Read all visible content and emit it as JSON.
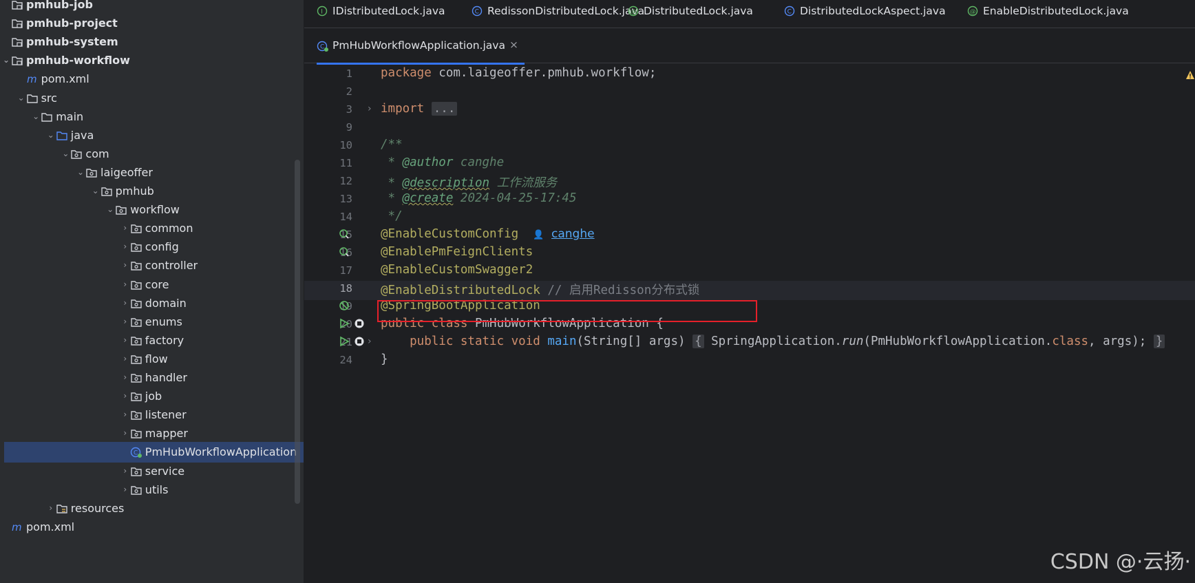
{
  "project_tree": {
    "items": [
      {
        "label": "pmhub-job",
        "bold": true,
        "icon": "module-folder-icon",
        "depth": 0,
        "chevron": "none"
      },
      {
        "label": "pmhub-project",
        "bold": true,
        "icon": "module-folder-icon",
        "depth": 0,
        "chevron": "none"
      },
      {
        "label": "pmhub-system",
        "bold": true,
        "icon": "module-folder-icon",
        "depth": 0,
        "chevron": "none"
      },
      {
        "label": "pmhub-workflow",
        "bold": true,
        "icon": "module-folder-icon",
        "depth": 0,
        "chevron": "down"
      },
      {
        "label": "pom.xml",
        "icon": "maven-icon",
        "depth": 1,
        "chevron": "none"
      },
      {
        "label": "src",
        "icon": "folder-icon",
        "depth": 1,
        "chevron": "down"
      },
      {
        "label": "main",
        "icon": "folder-icon",
        "depth": 2,
        "chevron": "down"
      },
      {
        "label": "java",
        "icon": "source-folder-icon",
        "depth": 3,
        "chevron": "down"
      },
      {
        "label": "com",
        "icon": "package-icon",
        "depth": 4,
        "chevron": "down"
      },
      {
        "label": "laigeoffer",
        "icon": "package-icon",
        "depth": 5,
        "chevron": "down"
      },
      {
        "label": "pmhub",
        "icon": "package-icon",
        "depth": 6,
        "chevron": "down"
      },
      {
        "label": "workflow",
        "icon": "package-icon",
        "depth": 7,
        "chevron": "down"
      },
      {
        "label": "common",
        "icon": "package-icon",
        "depth": 8,
        "chevron": "right"
      },
      {
        "label": "config",
        "icon": "package-icon",
        "depth": 8,
        "chevron": "right"
      },
      {
        "label": "controller",
        "icon": "package-icon",
        "depth": 8,
        "chevron": "right"
      },
      {
        "label": "core",
        "icon": "package-icon",
        "depth": 8,
        "chevron": "right"
      },
      {
        "label": "domain",
        "icon": "package-icon",
        "depth": 8,
        "chevron": "right"
      },
      {
        "label": "enums",
        "icon": "package-icon",
        "depth": 8,
        "chevron": "right"
      },
      {
        "label": "factory",
        "icon": "package-icon",
        "depth": 8,
        "chevron": "right"
      },
      {
        "label": "flow",
        "icon": "package-icon",
        "depth": 8,
        "chevron": "right"
      },
      {
        "label": "handler",
        "icon": "package-icon",
        "depth": 8,
        "chevron": "right"
      },
      {
        "label": "job",
        "icon": "package-icon",
        "depth": 8,
        "chevron": "right"
      },
      {
        "label": "listener",
        "icon": "package-icon",
        "depth": 8,
        "chevron": "right"
      },
      {
        "label": "mapper",
        "icon": "package-icon",
        "depth": 8,
        "chevron": "right"
      },
      {
        "label": "PmHubWorkflowApplication",
        "icon": "spring-class-icon",
        "depth": 8,
        "chevron": "none",
        "selected": true
      },
      {
        "label": "service",
        "icon": "package-icon",
        "depth": 8,
        "chevron": "right"
      },
      {
        "label": "utils",
        "icon": "package-icon",
        "depth": 8,
        "chevron": "right"
      },
      {
        "label": "resources",
        "icon": "resources-folder-icon",
        "depth": 3,
        "chevron": "right"
      },
      {
        "label": "pom.xml",
        "icon": "maven-icon",
        "depth": 0,
        "chevron": "none"
      }
    ]
  },
  "tabs_row1": [
    {
      "label": "IDistributedLock.java",
      "icon": "interface-icon"
    },
    {
      "label": "RedissonDistributedLock.java",
      "icon": "class-icon"
    },
    {
      "label": "DistributedLock.java",
      "icon": "annotation-icon"
    },
    {
      "label": "DistributedLockAspect.java",
      "icon": "class-icon"
    },
    {
      "label": "EnableDistributedLock.java",
      "icon": "annotation-icon"
    }
  ],
  "tabs_row2": [
    {
      "label": "PmHubWorkflowApplication.java",
      "icon": "spring-class-icon",
      "close": "×",
      "active": true
    }
  ],
  "code": {
    "line_numbers": [
      "1",
      "2",
      "3",
      "9",
      "10",
      "11",
      "12",
      "13",
      "14",
      "15",
      "16",
      "17",
      "18",
      "19",
      "20",
      "21",
      "24"
    ],
    "current_line": "18",
    "package_kw": "package",
    "package_name": " com.laigeoffer.pmhub.workflow;",
    "import_kw": "import",
    "import_fold": "...",
    "doc_open": "/**",
    "doc_author_prefix": " * ",
    "doc_author_tag": "@author",
    "doc_author_val": " canghe",
    "doc_desc_prefix": " * ",
    "doc_desc_tag": "@description",
    "doc_desc_val": " 工作流服务",
    "doc_create_prefix": " * ",
    "doc_create_tag": "@create",
    "doc_create_val": " 2024-04-25-17:45",
    "doc_close": " */",
    "ann1": "@EnableCustomConfig",
    "author_hint": "canghe",
    "ann2": "@EnablePmFeignClients",
    "ann3": "@EnableCustomSwagger2",
    "ann4": "@EnableDistributedLock",
    "ann4_comment": " // 启用Redisson分布式锁",
    "ann5": "@SpringBootApplication",
    "class_kw": "public class",
    "class_name": " PmHubWorkflowApplication {",
    "main_kw": "    public static void",
    "main_name": " main",
    "main_params": "(String[] args) ",
    "main_brace_open": "{",
    "main_body_cls": " SpringApplication.",
    "main_body_run": "run",
    "main_body_arg": "(PmHubWorkflowApplication.",
    "main_body_classkw": "class",
    "main_body_end": ", args); ",
    "main_brace_close": "}",
    "closing": "}"
  },
  "watermark": "CSDN @·云扬·",
  "colors": {
    "accent": "#3574f0",
    "highlight_box": "#e5202a",
    "selection": "#2e436e"
  }
}
